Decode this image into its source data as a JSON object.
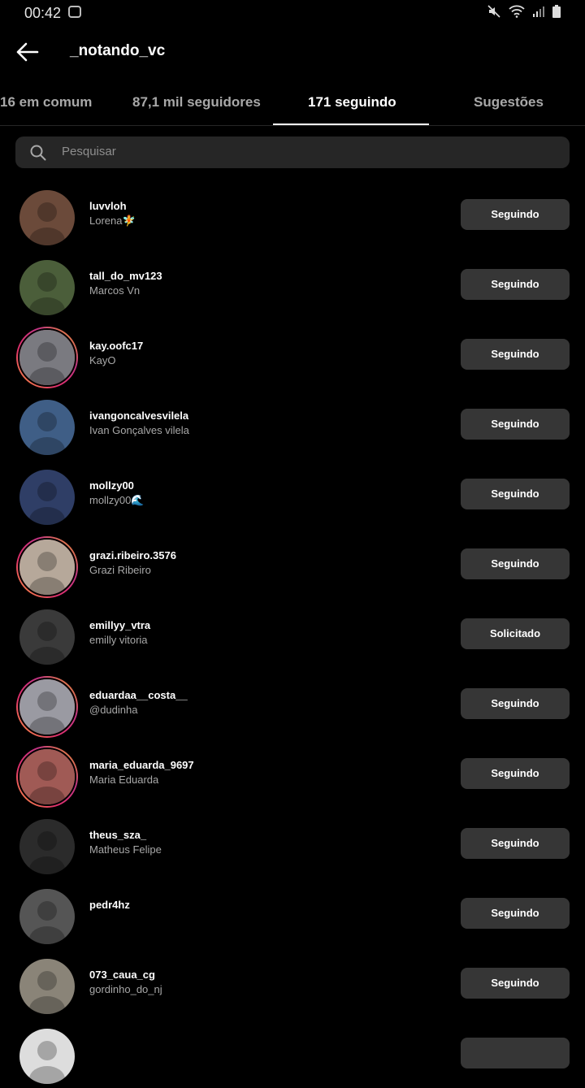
{
  "status": {
    "time": "00:42"
  },
  "header": {
    "title": "_notando_vc"
  },
  "tabs": [
    {
      "label": "16 em comum"
    },
    {
      "label": "87,1 mil seguidores"
    },
    {
      "label": "171 seguindo"
    },
    {
      "label": "Sugestões"
    }
  ],
  "search": {
    "placeholder": "Pesquisar"
  },
  "rows": [
    {
      "username": "luvvloh",
      "name": "Lorena🧚",
      "button": "Seguindo",
      "ring": false,
      "bg": "#6b4a3a"
    },
    {
      "username": "tall_do_mv123",
      "name": "Marcos Vn",
      "button": "Seguindo",
      "ring": false,
      "bg": "#4b5e3a"
    },
    {
      "username": "kay.oofc17",
      "name": "KayO",
      "button": "Seguindo",
      "ring": true,
      "bg": "#7a7a80"
    },
    {
      "username": "ivangoncalvesvilela",
      "name": "Ivan Gonçalves vilela",
      "button": "Seguindo",
      "ring": false,
      "bg": "#3f5e86"
    },
    {
      "username": "mollzy00",
      "name": "mollzy00🌊",
      "button": "Seguindo",
      "ring": false,
      "bg": "#2f3e66"
    },
    {
      "username": "grazi.ribeiro.3576",
      "name": "Grazi Ribeiro",
      "button": "Seguindo",
      "ring": true,
      "bg": "#b6a89a"
    },
    {
      "username": "emillyy_vtra",
      "name": "emilly vitoria",
      "button": "Solicitado",
      "ring": false,
      "bg": "#3a3a3a"
    },
    {
      "username": "eduardaa__costa__",
      "name": "@dudinha",
      "button": "Seguindo",
      "ring": true,
      "bg": "#9a9aa2"
    },
    {
      "username": "maria_eduarda_9697",
      "name": "Maria Eduarda",
      "button": "Seguindo",
      "ring": true,
      "bg": "#a05a55"
    },
    {
      "username": "theus_sza_",
      "name": "Matheus Felipe",
      "button": "Seguindo",
      "ring": false,
      "bg": "#2b2b2b"
    },
    {
      "username": "pedr4hz",
      "name": "",
      "button": "Seguindo",
      "ring": false,
      "bg": "#555555"
    },
    {
      "username": "073_caua_cg",
      "name": "gordinho_do_nj",
      "button": "Seguindo",
      "ring": false,
      "bg": "#8a8478"
    },
    {
      "username": "",
      "name": "",
      "button": "",
      "ring": false,
      "bg": "#dddddd"
    }
  ]
}
